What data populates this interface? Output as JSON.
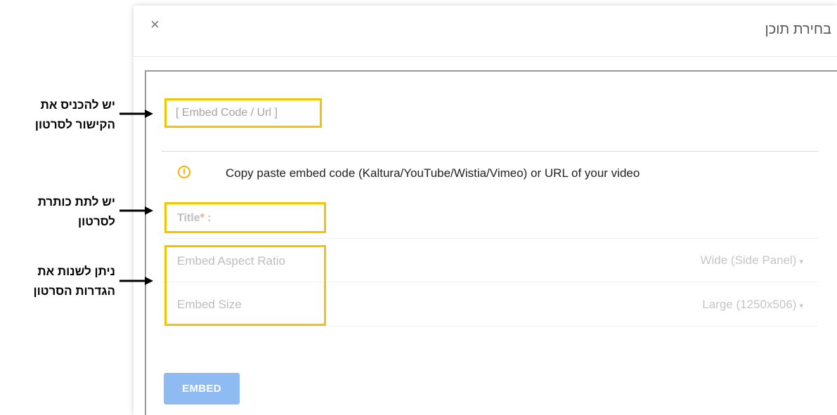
{
  "modal": {
    "title": "בחירת תוכן",
    "close_glyph": "×"
  },
  "form": {
    "embed_placeholder": "[ Embed Code / Url ]",
    "info_icon_glyph": "i",
    "info_text": "Copy paste embed code (Kaltura/YouTube/Wistia/Vimeo) or URL of your video",
    "title_label": "Title",
    "title_required_mark": "*",
    "title_suffix": " :",
    "aspect_ratio_label": "Embed Aspect Ratio",
    "aspect_ratio_value": "Wide (Side Panel)",
    "size_label": "Embed Size",
    "size_value": "Large (1250x506)",
    "caret_glyph": "▾",
    "embed_button": "EMBED"
  },
  "annotations": {
    "link_line1": "יש להכניס את",
    "link_line2": "הקישור לסרטון",
    "title_line1": "יש לתת כותרת",
    "title_line2": "לסרטון",
    "settings_line1": "ניתן לשנות את",
    "settings_line2": "הגדרות הסרטון"
  },
  "colors": {
    "highlight_border": "#f5c400",
    "info_icon": "#f0b400",
    "button_bg": "#8ebcf2",
    "required_star": "#f3a6a6"
  },
  "icons": {
    "close": "close-icon",
    "info": "info-icon",
    "dropdown": "chevron-down-icon",
    "arrow": "arrow-right-icon"
  }
}
